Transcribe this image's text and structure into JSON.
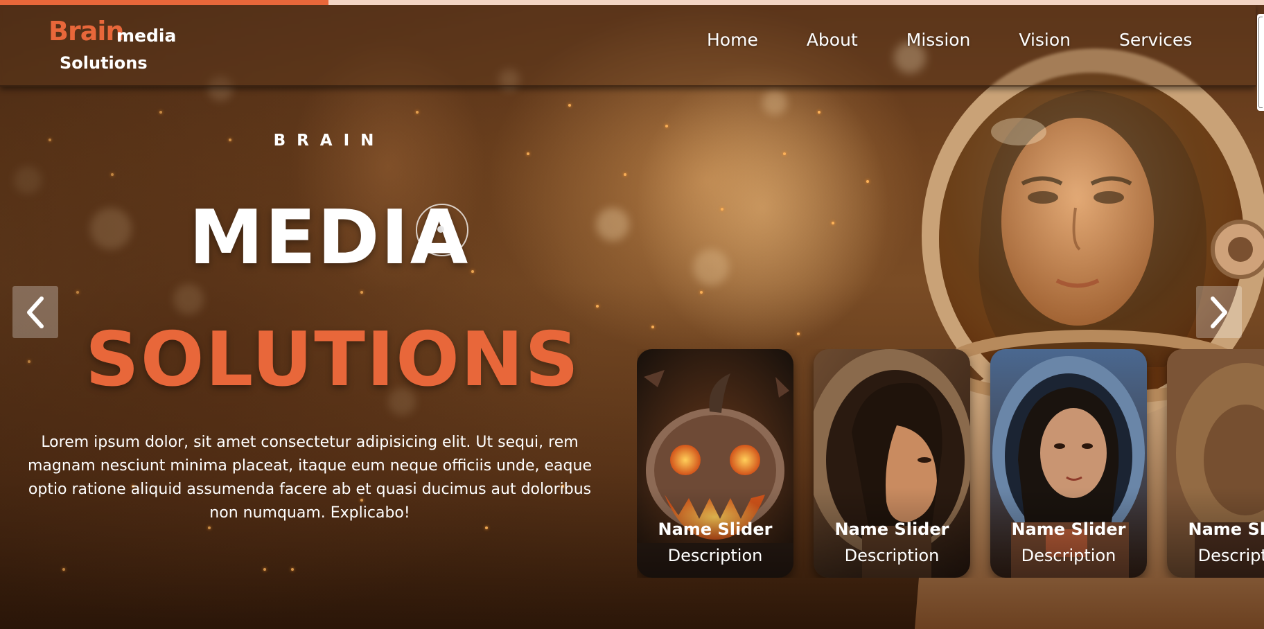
{
  "header": {
    "logo": {
      "brand": "Brain",
      "media": "media",
      "solutions": "Solutions"
    },
    "nav": [
      "Home",
      "About",
      "Mission",
      "Vision",
      "Services"
    ]
  },
  "hero": {
    "eyebrow": "BRAIN",
    "title": "MEDIA",
    "subtitle": "SOLUTIONS",
    "description": "Lorem ipsum dolor, sit amet consectetur adipisicing elit. Ut sequi, rem magnam nesciunt minima placeat, itaque eum neque officiis unde, eaque optio ratione aliquid assumenda facere ab et quasi ducimus aut doloribus non numquam. Explicabo!"
  },
  "slider": {
    "progress": 0.26,
    "prev_icon": "chevron-left-icon",
    "next_icon": "chevron-right-icon",
    "cards": [
      {
        "name": "Name Slider",
        "description": "Description",
        "image": "jack-o-lantern-pumpkin"
      },
      {
        "name": "Name Slider",
        "description": "Description",
        "image": "astronaut-woman-profile"
      },
      {
        "name": "Name Slider",
        "description": "Description",
        "image": "astronaut-woman-blue"
      },
      {
        "name": "Name Slider",
        "description": "Description",
        "image": "astronaut-blurred"
      }
    ]
  },
  "colors": {
    "accent": "#e8673a",
    "text": "#ffffff"
  }
}
